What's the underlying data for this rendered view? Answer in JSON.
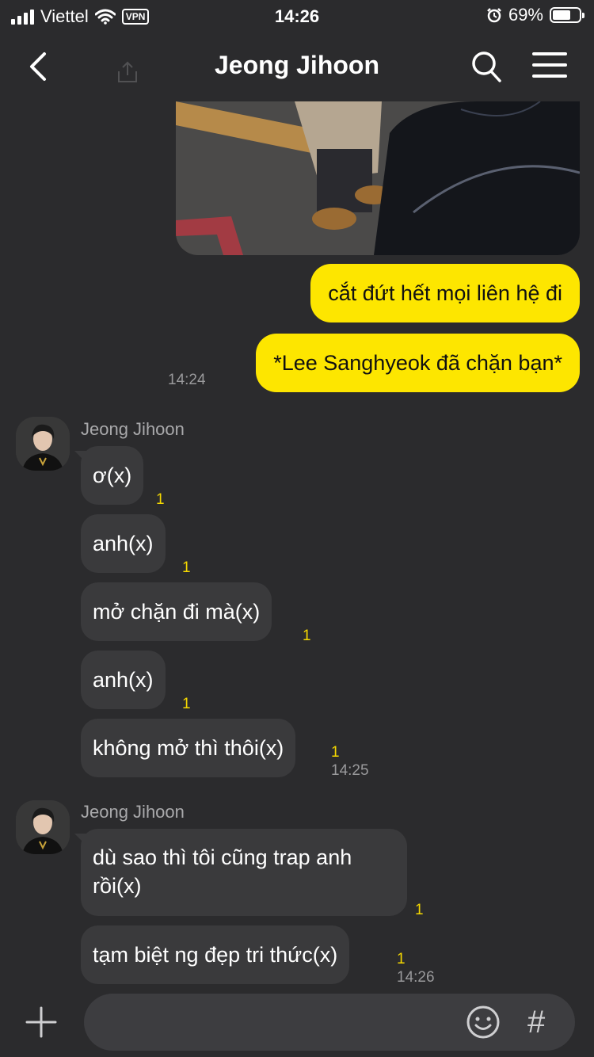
{
  "status": {
    "carrier": "Viettel",
    "vpn": "VPN",
    "time": "14:26",
    "battery": "69%",
    "battery_level": 0.69
  },
  "header": {
    "title": "Jeong Jihoon"
  },
  "messages_sent": [
    {
      "text": "cắt đứt hết mọi liên hệ đi"
    },
    {
      "text": "*Lee Sanghyeok đã chặn bạn*",
      "time": "14:24"
    }
  ],
  "group1": {
    "sender": "Jeong Jihoon",
    "messages": [
      {
        "text": "ơ(x)",
        "unread": "1"
      },
      {
        "text": "anh(x)",
        "unread": "1"
      },
      {
        "text": "mở chặn đi mà(x)",
        "unread": "1"
      },
      {
        "text": "anh(x)",
        "unread": "1"
      },
      {
        "text": "không mở thì thôi(x)",
        "unread": "1",
        "time": "14:25"
      }
    ]
  },
  "group2": {
    "sender": "Jeong Jihoon",
    "messages": [
      {
        "text": "dù sao thì tôi cũng trap anh rồi(x)",
        "unread": "1"
      },
      {
        "text": "tạm biệt ng đẹp tri thức(x)",
        "unread": "1",
        "time": "14:26"
      }
    ]
  },
  "input": {
    "placeholder": "",
    "hash": "#"
  },
  "colors": {
    "background": "#2b2b2d",
    "sent_bubble": "#fde600",
    "received_bubble": "#3a3a3c",
    "unread": "#f5d800"
  }
}
